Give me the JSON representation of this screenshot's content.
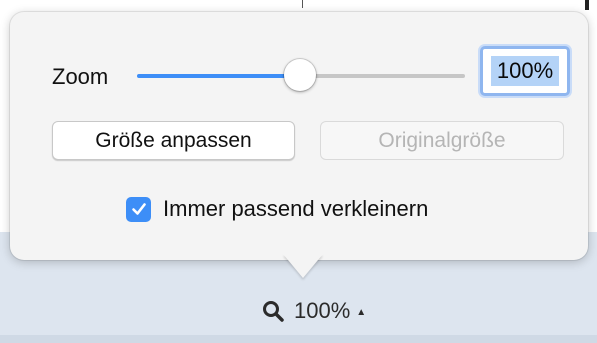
{
  "popover": {
    "zoom_label": "Zoom",
    "slider_level_percent": 50,
    "zoom_value": "100%",
    "fit_button_label": "Größe anpassen",
    "original_size_button_label": "Originalgröße",
    "shrink_checkbox_label": "Immer passend verkleinern",
    "shrink_checkbox_checked": true
  },
  "status_bar": {
    "zoom_text": "100%",
    "icons": [
      "magnifier-icon",
      "caret-up-icon"
    ]
  },
  "colors": {
    "accent": "#3d8ef7",
    "popover_background": "#f4f4f4",
    "bottom_bar": "#dde5ef"
  }
}
